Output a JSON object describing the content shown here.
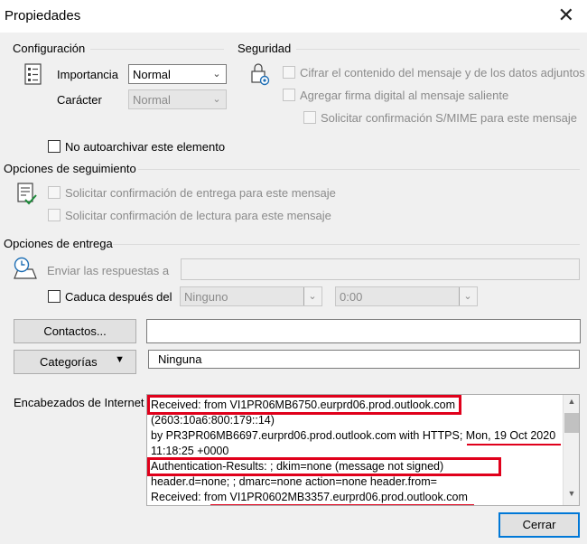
{
  "window": {
    "title": "Propiedades"
  },
  "config": {
    "section_title": "Configuración",
    "importance_label": "Importancia",
    "importance_value": "Normal",
    "character_label": "Carácter",
    "character_value": "Normal"
  },
  "security": {
    "section_title": "Seguridad",
    "encrypt_label": "Cifrar el contenido del mensaje y de los datos adjuntos",
    "signature_label": "Agregar firma digital al mensaje saliente",
    "smime_label": "Solicitar confirmación S/MIME para este mensaje"
  },
  "autoarchive_label": "No autoarchivar este elemento",
  "tracking": {
    "section_title": "Opciones de seguimiento",
    "delivery_label": "Solicitar confirmación de entrega para este mensaje",
    "read_label": "Solicitar confirmación de lectura para este mensaje"
  },
  "delivery": {
    "section_title": "Opciones de entrega",
    "replies_label": "Enviar las respuestas a",
    "expires_label": "Caduca después del",
    "expires_date_value": "Ninguno",
    "expires_time_value": "0:00"
  },
  "contacts_button": "Contactos...",
  "categories_button": "Categorías",
  "categories_value": "Ninguna",
  "headers": {
    "label": "Encabezados de Internet",
    "lines": [
      "Received: from VI1PR06MB6750.eurprd06.prod.outlook.com",
      "(2603:10a6:800:179::14)",
      " by PR3PR06MB6697.eurprd06.prod.outlook.com with HTTPS; Mon, 19 Oct 2020",
      " 11:18:25 +0000",
      "Authentication-Results:                    ; dkim=none (message not signed)",
      " header.d=none;                  ; dmarc=none action=none header.from=",
      "Received: from VI1PR0602MB3357.eurprd06.prod.outlook.com"
    ]
  },
  "close_button": "Cerrar",
  "colors": {
    "annotation_red": "#e0001b",
    "accent_blue": "#0078d7"
  }
}
